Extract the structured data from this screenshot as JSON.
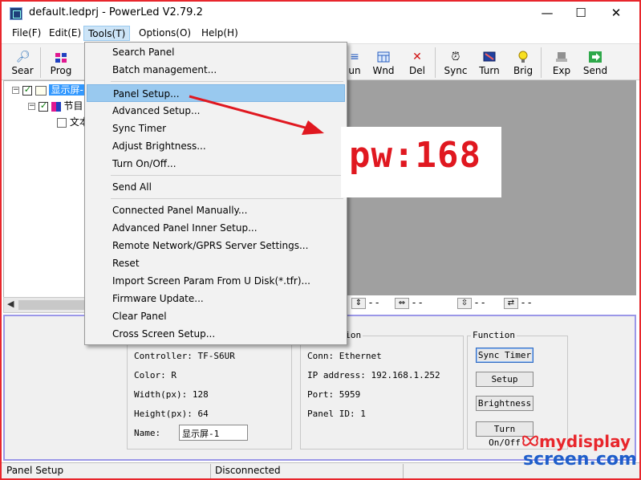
{
  "window": {
    "title": "default.ledprj - PowerLed V2.79.2",
    "minimize": "—",
    "maximize": "☐",
    "close": "✕"
  },
  "menubar": [
    "File(F)",
    "Edit(E)",
    "Tools(T)",
    "Options(O)",
    "Help(H)"
  ],
  "toolbar": {
    "left": [
      {
        "label": "Sear",
        "icon": "search-icon"
      },
      {
        "label": "Prog",
        "icon": "program-icon"
      }
    ],
    "right": [
      {
        "label": "un",
        "icon": "run-icon"
      },
      {
        "label": "Wnd",
        "icon": "window-icon"
      },
      {
        "label": "Del",
        "icon": "delete-icon"
      },
      {
        "label": "Sync",
        "icon": "sync-icon"
      },
      {
        "label": "Turn",
        "icon": "turn-icon"
      },
      {
        "label": "Brig",
        "icon": "brightness-icon"
      },
      {
        "label": "Exp",
        "icon": "export-icon"
      },
      {
        "label": "Send",
        "icon": "send-icon"
      }
    ]
  },
  "tree": {
    "items": [
      {
        "label": "显示屏-"
      },
      {
        "label": "节目"
      },
      {
        "label": "文本"
      }
    ]
  },
  "tools_menu": {
    "groups": [
      [
        "Search Panel",
        "Batch management..."
      ],
      [
        "Panel Setup...",
        "Advanced Setup...",
        "Sync Timer",
        "Adjust Brightness...",
        "Turn On/Off..."
      ],
      [
        "Send All"
      ],
      [
        "Connected Panel Manually...",
        "Advanced Panel Inner Setup...",
        "Remote Network/GPRS Server Settings...",
        "Reset",
        "Import Screen Param From U Disk(*.tfr)...",
        "Firmware Update...",
        "Clear Panel",
        "Cross Screen Setup..."
      ]
    ],
    "selected": "Panel Setup..."
  },
  "annotation": {
    "text": "pw:168",
    "color": "#e01820"
  },
  "layout_controls": [
    "- -",
    "- -",
    "- -",
    "- -"
  ],
  "properties": {
    "controller": "Controller: TF-S6UR",
    "color": "Color: R",
    "width": "Width(px): 128",
    "height": "Height(px): 64",
    "name_label": "Name:",
    "name_value": "显示屏-1"
  },
  "communication": {
    "label": "ation",
    "conn": "Conn: Ethernet",
    "ip": "IP address: 192.168.1.252",
    "port": "Port: 5959",
    "panel_id": "Panel ID: 1"
  },
  "function": {
    "label": "Function",
    "buttons": [
      "Sync Timer",
      "Setup",
      "Brightness",
      "Turn On/Off"
    ]
  },
  "status": {
    "left": "Panel Setup",
    "middle": "Disconnected"
  },
  "watermark": {
    "line1": "mydisplay",
    "line2": "screen.com"
  },
  "colors": {
    "accent_red": "#e8262c",
    "menu_highlight": "#99c9ef",
    "panel_border": "#9b97e8"
  }
}
